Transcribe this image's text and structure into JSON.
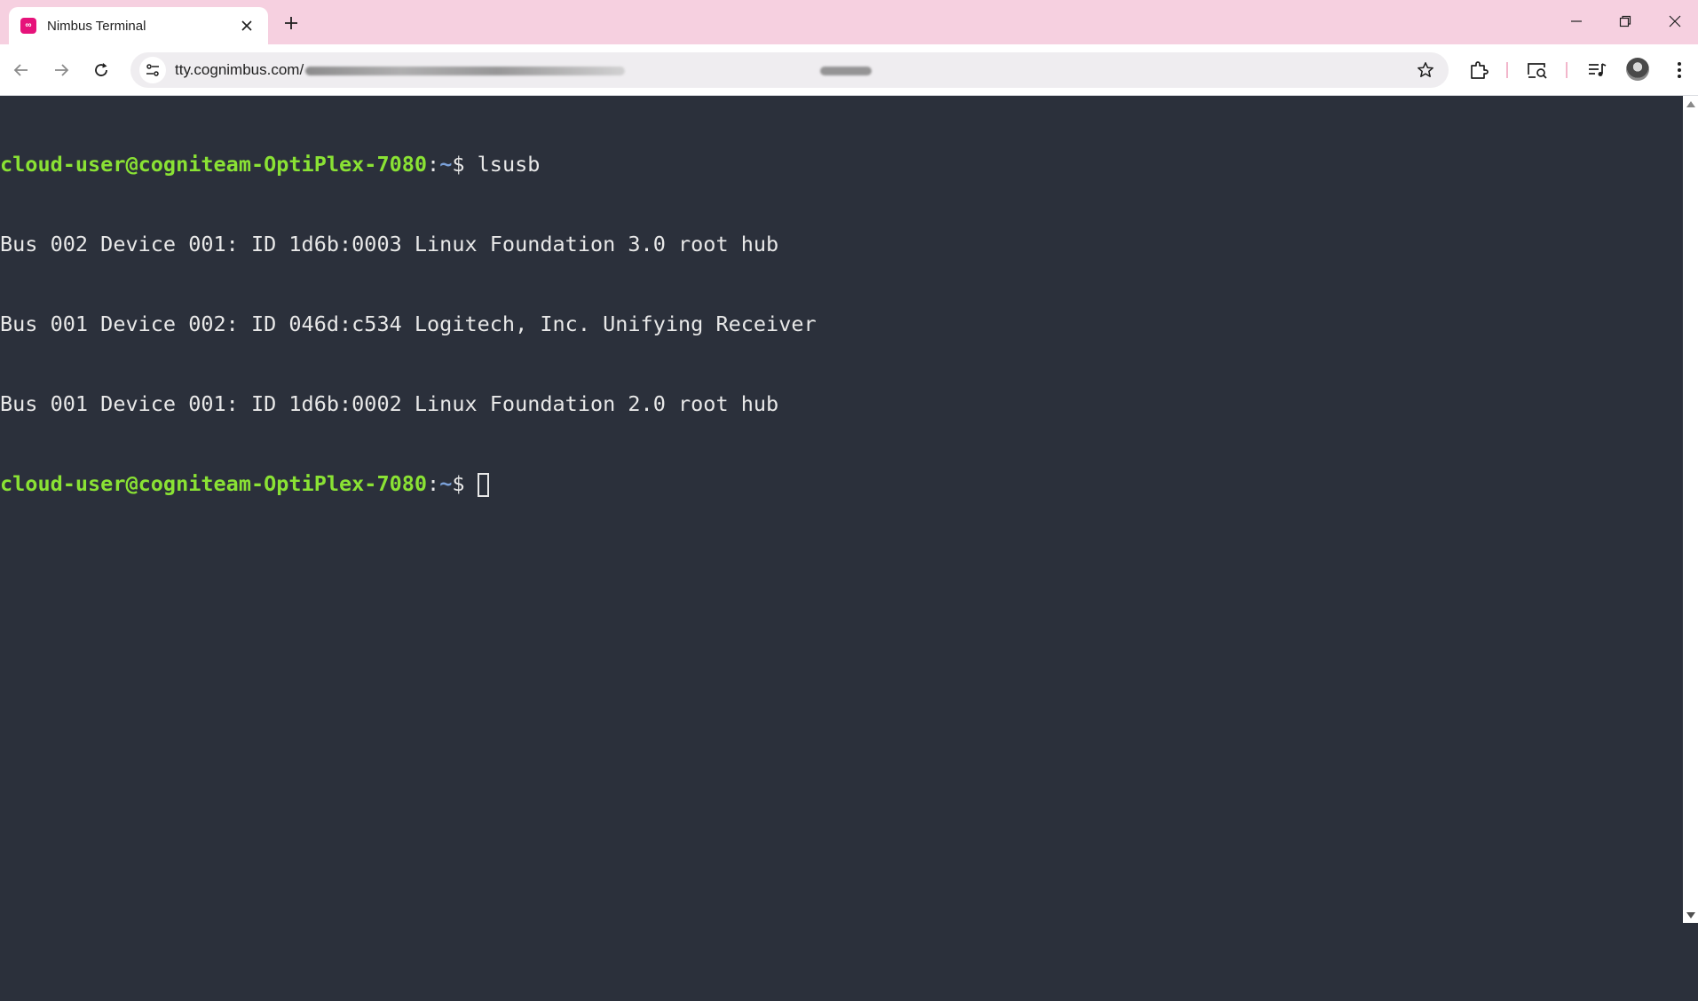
{
  "browser": {
    "tab": {
      "title": "Nimbus Terminal",
      "favicon_text": "∞"
    },
    "address_bar": {
      "url": "tty.cognimbus.com/"
    },
    "colors": {
      "tabstrip": "#f6d0e0",
      "favicon": "#e6127a",
      "terminal_bg": "#2b303b",
      "prompt_user": "#8ae234",
      "prompt_path": "#7aa0d8"
    },
    "icons": [
      "back-icon",
      "forward-icon",
      "reload-icon",
      "site-info-icon",
      "bookmark-star-icon",
      "extensions-icon",
      "cast-search-icon",
      "media-controls-icon",
      "profile-avatar",
      "menu-kebab-icon",
      "minimize-icon",
      "restore-icon",
      "close-icon",
      "new-tab-icon"
    ]
  },
  "terminal": {
    "prompt_user_host": "cloud-user@cogniteam-OptiPlex-7080",
    "prompt_sep": ":",
    "prompt_path": "~",
    "prompt_sign": "$ ",
    "command": "lsusb",
    "output": [
      "Bus 002 Device 001: ID 1d6b:0003 Linux Foundation 3.0 root hub",
      "Bus 001 Device 002: ID 046d:c534 Logitech, Inc. Unifying Receiver",
      "Bus 001 Device 001: ID 1d6b:0002 Linux Foundation 2.0 root hub"
    ]
  }
}
